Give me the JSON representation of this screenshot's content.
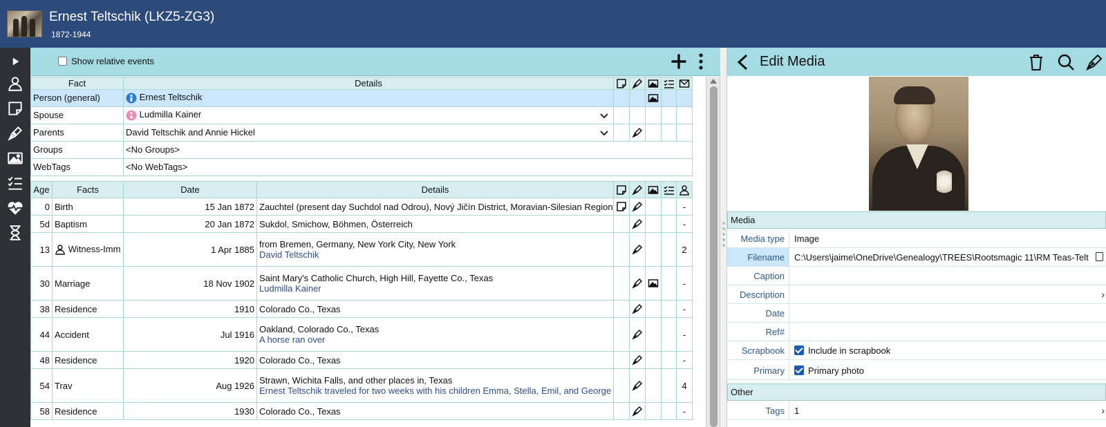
{
  "header": {
    "title": "Ernest Teltschik (LKZ5-ZG3)",
    "dates": "1872-1944"
  },
  "toolbar": {
    "show_relative_events": "Show relative events"
  },
  "person_table": {
    "headers": {
      "fact": "Fact",
      "details": "Details"
    },
    "rows": [
      {
        "fact": "Person (general)",
        "details": "Ernest Teltschik"
      },
      {
        "fact": "Spouse",
        "details": "Ludmilla Kainer"
      },
      {
        "fact": "Parents",
        "details": "David Teltschik and Annie Hickel"
      },
      {
        "fact": "Groups",
        "details": "<No Groups>"
      },
      {
        "fact": "WebTags",
        "details": "<No WebTags>"
      }
    ]
  },
  "facts_table": {
    "headers": {
      "age": "Age",
      "facts": "Facts",
      "date": "Date",
      "details": "Details"
    },
    "rows": [
      {
        "age": "0",
        "fact": "Birth",
        "date": "15 Jan 1872",
        "details": "Zauchtel (present day Suchdol nad Odrou), Nový Jičín District, Moravian-Silesian Region, Czech",
        "sub": "",
        "count": "-"
      },
      {
        "age": "5d",
        "fact": "Baptism",
        "date": "20 Jan 1872",
        "details": "Sukdol, Smichow, Böhmen, Österreich",
        "sub": "",
        "count": "-"
      },
      {
        "age": "13",
        "fact": "Witness-Imm",
        "date": "1 Apr 1885",
        "details": "from Bremen, Germany, New York City, New York",
        "sub": "David Teltschik",
        "count": "2"
      },
      {
        "age": "30",
        "fact": "Marriage",
        "date": "18 Nov 1902",
        "details": "Saint Mary's Catholic Church, High Hill, Fayette Co., Texas",
        "sub": "Ludmilla Kainer",
        "count": "-"
      },
      {
        "age": "38",
        "fact": "Residence",
        "date": "1910",
        "details": "Colorado Co., Texas",
        "sub": "",
        "count": "-"
      },
      {
        "age": "44",
        "fact": "Accident",
        "date": "Jul 1916",
        "details": "Oakland, Colorado Co., Texas",
        "sub": "A horse ran over",
        "count": "-"
      },
      {
        "age": "48",
        "fact": "Residence",
        "date": "1920",
        "details": "Colorado Co., Texas",
        "sub": "",
        "count": "-"
      },
      {
        "age": "54",
        "fact": "Trav",
        "date": "Aug 1926",
        "details": "Strawn, Wichita Falls, and other places in, Texas",
        "sub": "Ernest Teltschik traveled for two weeks with his children Emma, Stella, Emil, and George to visit",
        "count": "4"
      },
      {
        "age": "58",
        "fact": "Residence",
        "date": "1930",
        "details": "Colorado Co., Texas",
        "sub": "",
        "count": "-"
      }
    ]
  },
  "edit_media": {
    "title": "Edit Media",
    "media_section": "Media",
    "other_section": "Other",
    "fields": {
      "media_type_label": "Media type",
      "media_type_value": "Image",
      "filename_label": "Filename",
      "filename_value": "C:\\Users\\jaime\\OneDrive\\Genealogy\\TREES\\Rootsmagic 11\\RM Teas-Teltschik_",
      "caption_label": "Caption",
      "description_label": "Description",
      "date_label": "Date",
      "ref_label": "Ref#",
      "scrapbook_label": "Scrapbook",
      "scrapbook_value": "Include in scrapbook",
      "primary_label": "Primary",
      "primary_value": "Primary photo",
      "tags_label": "Tags",
      "tags_value": "1"
    }
  },
  "colors": {
    "header_bg": "#2d4a7c",
    "toolbar_bg": "#a5dbe3",
    "sidebar_bg": "#2f3036",
    "selected_row": "#cce6fb",
    "link_text": "#2f4f8a",
    "checkbox": "#1a5bb5"
  }
}
